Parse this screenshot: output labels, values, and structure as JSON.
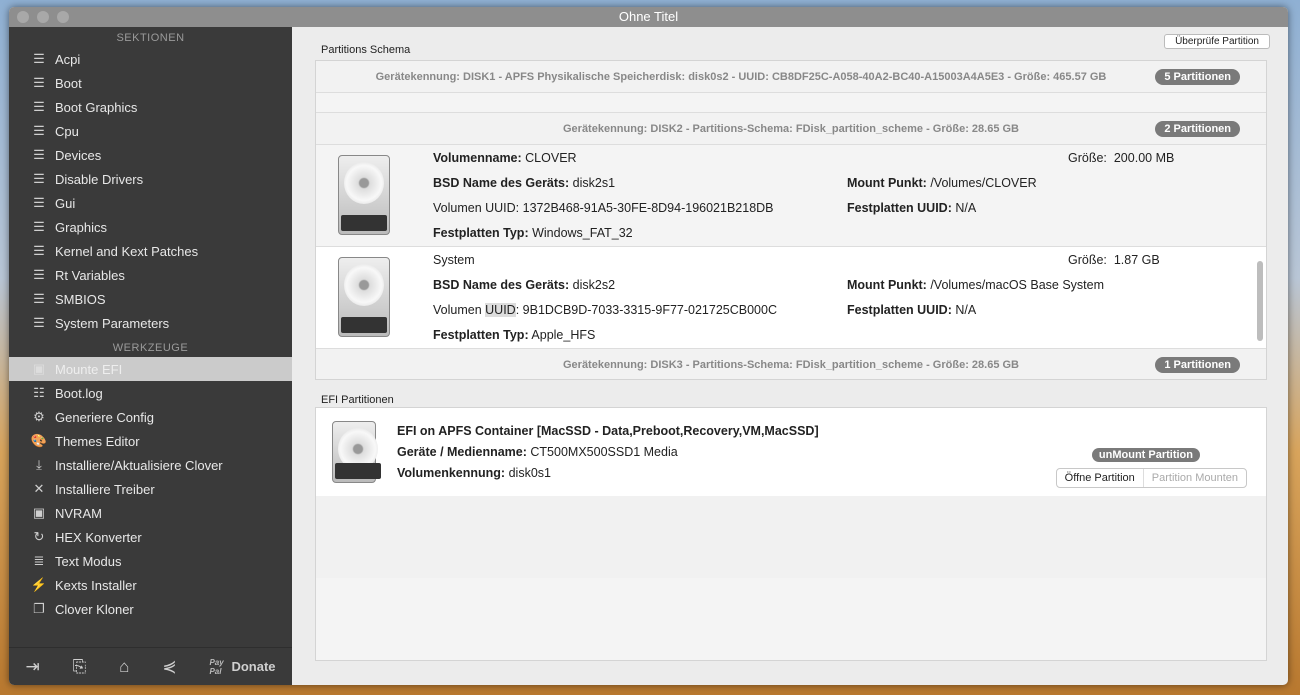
{
  "window": {
    "title": "Ohne Titel"
  },
  "sidebar": {
    "sections_header": "SEKTIONEN",
    "sections": [
      {
        "label": "Acpi"
      },
      {
        "label": "Boot"
      },
      {
        "label": "Boot Graphics"
      },
      {
        "label": "Cpu"
      },
      {
        "label": "Devices"
      },
      {
        "label": "Disable Drivers"
      },
      {
        "label": "Gui"
      },
      {
        "label": "Graphics"
      },
      {
        "label": "Kernel and Kext Patches"
      },
      {
        "label": "Rt Variables"
      },
      {
        "label": "SMBIOS"
      },
      {
        "label": "System Parameters"
      }
    ],
    "tools_header": "WERKZEUGE",
    "tools": [
      {
        "label": "Mounte EFI",
        "icon": "disk-icon"
      },
      {
        "label": "Boot.log",
        "icon": "log-search-icon"
      },
      {
        "label": "Generiere Config",
        "icon": "gears-icon"
      },
      {
        "label": "Themes Editor",
        "icon": "palette-icon"
      },
      {
        "label": "Installiere/Aktualisiere Clover",
        "icon": "download-icon"
      },
      {
        "label": "Installiere Treiber",
        "icon": "tools-icon"
      },
      {
        "label": "NVRAM",
        "icon": "chip-icon"
      },
      {
        "label": "HEX Konverter",
        "icon": "refresh-icon"
      },
      {
        "label": "Text Modus",
        "icon": "text-icon"
      },
      {
        "label": "Kexts Installer",
        "icon": "plug-icon"
      },
      {
        "label": "Clover Kloner",
        "icon": "clone-icon"
      }
    ],
    "footer": {
      "paypal": "Pay Pal",
      "donate": "Donate"
    }
  },
  "partitions": {
    "label": "Partitions Schema",
    "check_button": "Überprüfe Partition",
    "disk1": {
      "header": "Gerätekennung: DISK1 - APFS Physikalische Speicherdisk: disk0s2 - UUID: CB8DF25C-A058-40A2-BC40-A15003A4A5E3 - Größe: 465.57 GB",
      "badge": "5 Partitionen"
    },
    "disk2": {
      "header": "Gerätekennung: DISK2 - Partitions-Schema: FDisk_partition_scheme - Größe: 28.65 GB",
      "badge": "2 Partitionen",
      "parts": [
        {
          "name_label": "Volumenname:",
          "name": "CLOVER",
          "size_label": "Größe:",
          "size": "200.00 MB",
          "bsd_label": "BSD Name des Geräts:",
          "bsd": "disk2s1",
          "mount_label": "Mount Punkt:",
          "mount": "/Volumes/CLOVER",
          "uuid_label": "Volumen UUID:",
          "uuid": "1372B468-91A5-30FE-8D94-196021B218DB",
          "disk_uuid_label": "Festplatten UUID:",
          "disk_uuid": "N/A",
          "type_label": "Festplatten Typ:",
          "type": "Windows_FAT_32"
        },
        {
          "name": "System",
          "size_label": "Größe:",
          "size": "1.87 GB",
          "bsd_label": "BSD Name des Geräts:",
          "bsd": "disk2s2",
          "mount_label": "Mount Punkt:",
          "mount": "/Volumes/macOS Base System",
          "uuid_label_a": "Volumen",
          "uuid_label_b": "UUID",
          "uuid": ": 9B1DCB9D-7033-3315-9F77-021725CB000C",
          "disk_uuid_label": "Festplatten UUID:",
          "disk_uuid": "N/A",
          "type_label": "Festplatten Typ:",
          "type": "Apple_HFS"
        }
      ]
    },
    "disk3": {
      "header": "Gerätekennung: DISK3 - Partitions-Schema: FDisk_partition_scheme - Größe: 28.65 GB",
      "badge": "1 Partitionen"
    }
  },
  "efi": {
    "label": "EFI Partitionen",
    "title": "EFI on APFS Container [MacSSD - Data,Preboot,Recovery,VM,MacSSD]",
    "media_label": "Geräte / Medienname:",
    "media": "CT500MX500SSD1 Media",
    "vol_label": "Volumenkennung:",
    "vol": "disk0s1",
    "unmount": "unMount Partition",
    "open": "Öffne Partition",
    "mount": "Partition Mounten"
  }
}
